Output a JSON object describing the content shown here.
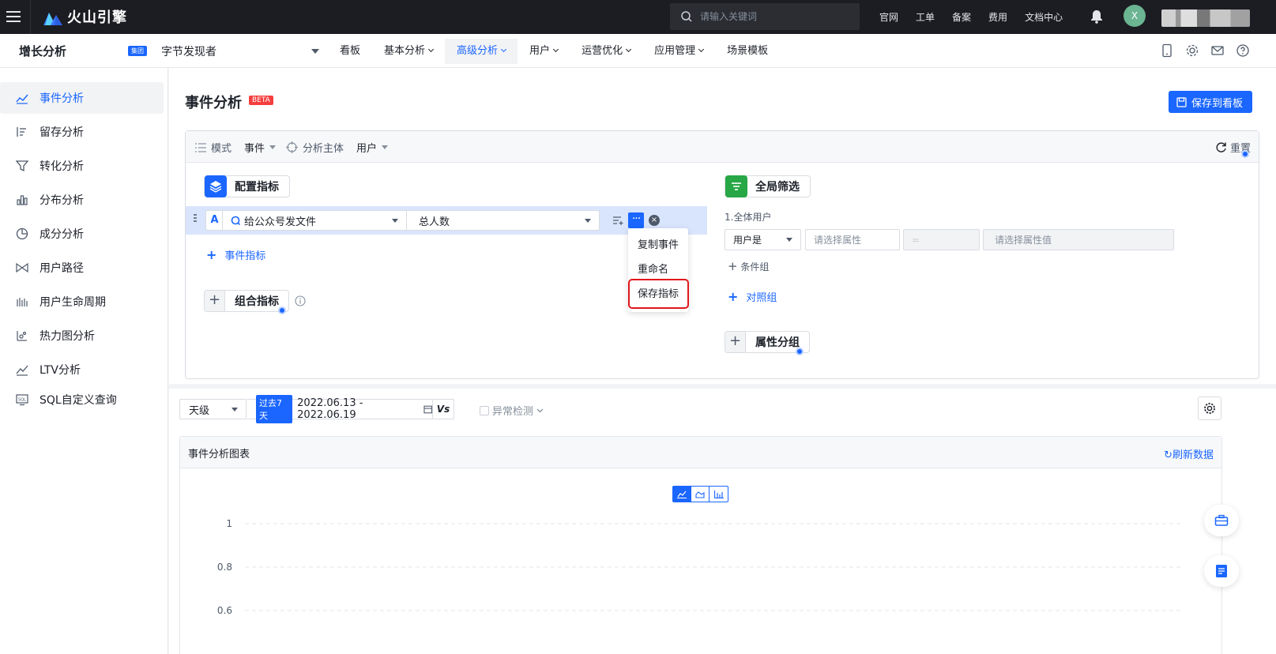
{
  "topbar": {
    "brand": "火山引擎",
    "search_placeholder": "请输入关键词",
    "links": [
      "官网",
      "工单",
      "备案",
      "费用",
      "文档中心"
    ],
    "avatar_initial": "X"
  },
  "subnav": {
    "app_title": "增长分析",
    "group_badge": "集团",
    "app_name": "字节发现者",
    "tabs": [
      {
        "label": "看板",
        "has_menu": false
      },
      {
        "label": "基本分析",
        "has_menu": true
      },
      {
        "label": "高级分析",
        "has_menu": true,
        "active": true
      },
      {
        "label": "用户",
        "has_menu": true
      },
      {
        "label": "运营优化",
        "has_menu": true
      },
      {
        "label": "应用管理",
        "has_menu": true
      },
      {
        "label": "场景模板",
        "has_menu": false
      }
    ]
  },
  "sidebar": {
    "items": [
      {
        "label": "事件分析",
        "icon": "line-chart-icon",
        "active": true
      },
      {
        "label": "留存分析",
        "icon": "retention-icon"
      },
      {
        "label": "转化分析",
        "icon": "funnel-icon"
      },
      {
        "label": "分布分析",
        "icon": "bar-chart-icon"
      },
      {
        "label": "成分分析",
        "icon": "pie-icon"
      },
      {
        "label": "用户路径",
        "icon": "path-icon"
      },
      {
        "label": "用户生命周期",
        "icon": "lifecycle-icon"
      },
      {
        "label": "热力图分析",
        "icon": "heatmap-icon"
      },
      {
        "label": "LTV分析",
        "icon": "ltv-icon"
      },
      {
        "label": "SQL自定义查询",
        "icon": "sql-icon"
      }
    ]
  },
  "page": {
    "title": "事件分析",
    "beta": "BETA",
    "save_board": "保存到看板"
  },
  "panel": {
    "mode_label": "模式",
    "mode_value": "事件",
    "subject_label": "分析主体",
    "subject_value": "用户",
    "reset": "重置",
    "config_title": "配置指标",
    "metric_letter": "A",
    "metric_event": "给公众号发文件",
    "metric_agg": "总人数",
    "add_event_metric": "事件指标",
    "combo_metric": "组合指标",
    "dropdown": [
      "复制事件",
      "重命名",
      "保存指标"
    ],
    "filter_title": "全局筛选",
    "filter_sub": "1.全体用户",
    "filter_user": "用户是",
    "filter_attr_placeholder": "请选择属性",
    "filter_op": "=",
    "filter_value_placeholder": "请选择属性值",
    "condition_group": "条件组",
    "compare_group": "对照组",
    "attr_group": "属性分组"
  },
  "toolbar": {
    "granularity": "天级",
    "period_chip": "过去7天",
    "date_range": "2022.06.13 - 2022.06.19",
    "vs": "Vs",
    "anomaly": "异常检测"
  },
  "chart": {
    "title": "事件分析图表",
    "refresh": "刷新数据"
  },
  "chart_data": {
    "type": "line",
    "title": "",
    "xlabel": "",
    "ylabel": "",
    "y_ticks": [
      1,
      0.8,
      0.6
    ],
    "grid": true,
    "series": []
  },
  "colors": {
    "accent": "#1a66ff",
    "topbar": "#1c1d22",
    "highlight_border": "#e0181c",
    "filter_icon": "#27a745",
    "config_icon": "#1a66ff"
  }
}
